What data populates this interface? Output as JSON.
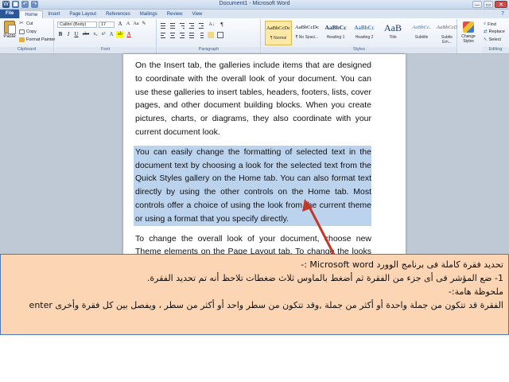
{
  "titlebar": {
    "title": "Document1 - Microsoft Word",
    "quick_access": [
      "W",
      "💾",
      "↶",
      "↷"
    ],
    "window_buttons": [
      "—",
      "▭",
      "✕"
    ]
  },
  "tabs": [
    {
      "label": "File"
    },
    {
      "label": "Home"
    },
    {
      "label": "Insert"
    },
    {
      "label": "Page Layout"
    },
    {
      "label": "References"
    },
    {
      "label": "Mailings"
    },
    {
      "label": "Review"
    },
    {
      "label": "View"
    }
  ],
  "ribbon": {
    "clipboard": {
      "label": "Clipboard",
      "paste": "Paste",
      "cut": "Cut",
      "copy": "Copy",
      "format_painter": "Format Painter"
    },
    "font": {
      "label": "Font",
      "font_name": "Calibri (Body)",
      "font_size": "17",
      "row1": [
        "A",
        "A",
        "Aa",
        "✎"
      ],
      "row2": [
        "B",
        "I",
        "U",
        "abe",
        "x₂",
        "x²",
        "A",
        "ab",
        "A"
      ]
    },
    "paragraph": {
      "label": "Paragraph"
    },
    "styles": {
      "label": "Styles",
      "items": [
        {
          "sample": "AaBbCcDc",
          "name": "¶ Normal"
        },
        {
          "sample": "AaBbCcDc",
          "name": "¶ No Spaci..."
        },
        {
          "sample": "AaBbCc",
          "name": "Heading 1"
        },
        {
          "sample": "AaBbCc",
          "name": "Heading 2"
        },
        {
          "sample": "AaB",
          "name": "Title"
        },
        {
          "sample": "AaBbCc.",
          "name": "Subtitle"
        },
        {
          "sample": "AaBbCcDc",
          "name": "Subtle Em..."
        }
      ],
      "change_styles": "Change Styles"
    },
    "editing": {
      "label": "Editing",
      "find": "Find",
      "replace": "Replace",
      "select": "Select"
    }
  },
  "document": {
    "paragraphs": [
      "On the Insert tab, the galleries include items that are designed to coordinate with the overall look of your document. You can use these galleries to insert tables, headers, footers, lists, cover pages, and other document building blocks. When you create pictures, charts, or diagrams, they also coordinate with your current document look.",
      "You can easily change the formatting of selected text in the document text by choosing a look for the selected text from the Quick Styles gallery on the Home tab. You can also format text directly by using the other controls on the Home tab. Most controls offer a choice of using the look from the current theme or using a format that you specify directly.",
      "To change the overall look of your document, choose new Theme elements on the Page Layout tab. To change the looks available in"
    ]
  },
  "caption": {
    "line1": "تحديد فقرة كاملة فى برنامج الوورد Microsoft word :-",
    "line2": "1- ضع المؤشر فى أى جزء من الفقرة ثم أضغط بالماوس ثلاث ضغطات تلاحظ أنه تم تحديد الفقرة.",
    "line3": "ملحوظة هامة:-",
    "line4": "الفقرة قد تتكون من جملة واحدة أو أكثر من جملة ,وقد تتكون من سطر واحد أو أكثر من سطر ، ويفصل بين كل فقرة وأخرى enter"
  },
  "colors": {
    "caption_bg": "#fcd5b4",
    "selection": "#bcd3ee",
    "arrow": "#c0392b",
    "file_tab": "#2b5797"
  }
}
